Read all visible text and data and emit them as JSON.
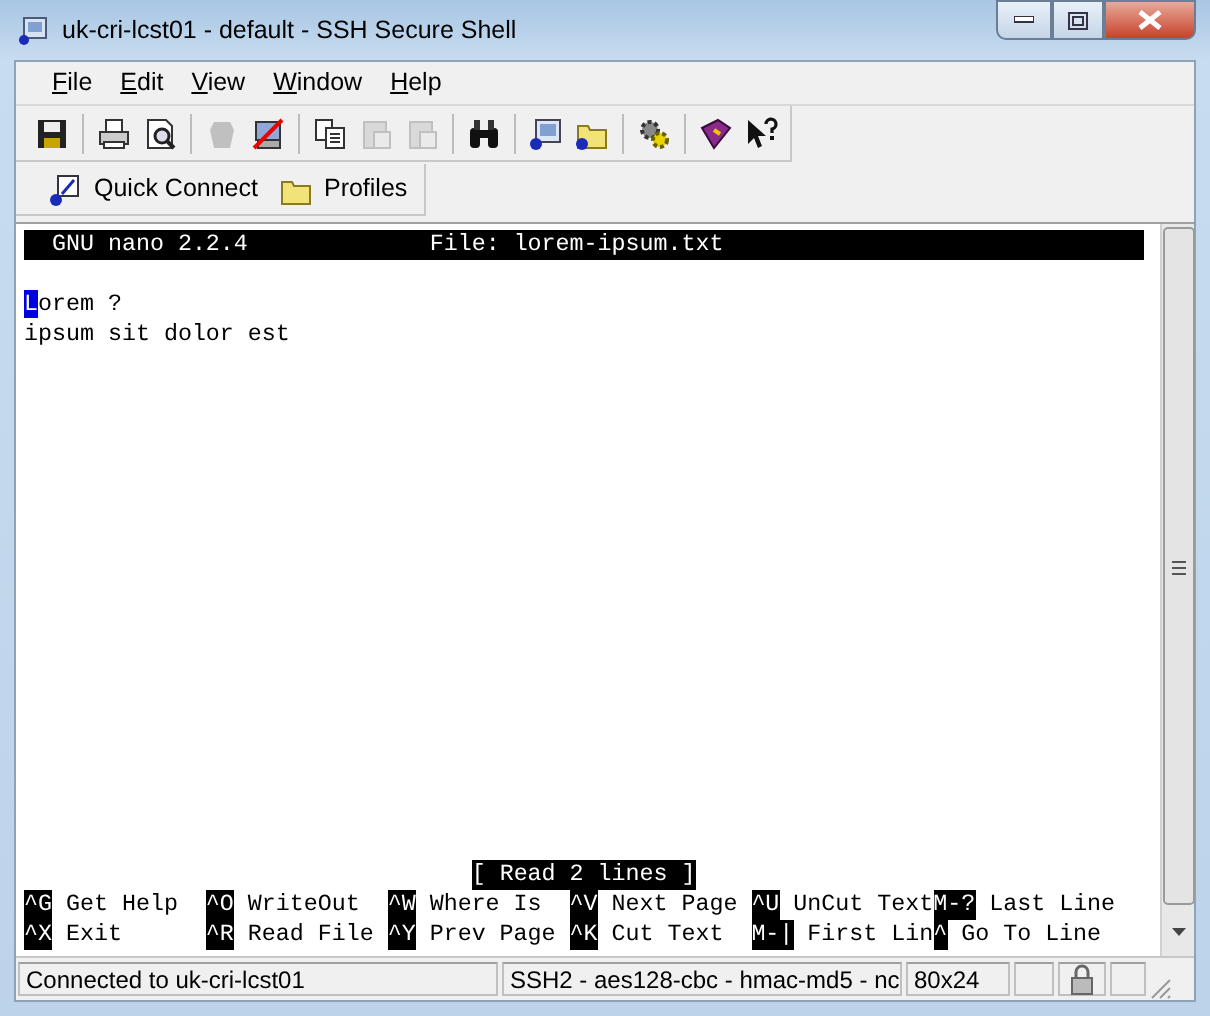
{
  "window": {
    "title": "uk-cri-lcst01 - default - SSH Secure Shell"
  },
  "menu": [
    {
      "label": "File"
    },
    {
      "label": "Edit"
    },
    {
      "label": "View"
    },
    {
      "label": "Window"
    },
    {
      "label": "Help"
    }
  ],
  "toolbar": [
    {
      "kind": "save",
      "disabled": false
    },
    {
      "kind": "separator"
    },
    {
      "kind": "print",
      "disabled": false
    },
    {
      "kind": "preview",
      "disabled": false
    },
    {
      "kind": "separator"
    },
    {
      "kind": "blob",
      "disabled": true
    },
    {
      "kind": "disconnect",
      "disabled": false
    },
    {
      "kind": "separator"
    },
    {
      "kind": "copy",
      "disabled": false
    },
    {
      "kind": "paste",
      "disabled": true
    },
    {
      "kind": "paste",
      "disabled": true
    },
    {
      "kind": "separator"
    },
    {
      "kind": "find",
      "disabled": false
    },
    {
      "kind": "separator"
    },
    {
      "kind": "terminal",
      "disabled": false
    },
    {
      "kind": "folder",
      "disabled": false
    },
    {
      "kind": "separator"
    },
    {
      "kind": "gear",
      "disabled": false
    },
    {
      "kind": "separator"
    },
    {
      "kind": "book",
      "disabled": false
    },
    {
      "kind": "whatsthis",
      "disabled": false
    }
  ],
  "quickbar": [
    {
      "kind": "connect",
      "label": "Quick Connect"
    },
    {
      "kind": "folder",
      "label": "Profiles"
    }
  ],
  "terminal": {
    "header_left": "GNU nano 2.2.4",
    "header_center": "File: lorem-ipsum.txt",
    "lines": [
      {
        "cursor": "L",
        "text": "orem ?"
      },
      {
        "text": "ipsum sit dolor est"
      }
    ],
    "message": "[ Read 2 lines ]",
    "shortcut_rows": [
      [
        {
          "key": "^G",
          "label": "Get Help"
        },
        {
          "key": "^O",
          "label": "WriteOut"
        },
        {
          "key": "^W",
          "label": "Where Is"
        },
        {
          "key": "^V",
          "label": "Next Page"
        },
        {
          "key": "^U",
          "label": "UnCut Text"
        },
        {
          "key": "M-?",
          "label": "Last Line"
        }
      ],
      [
        {
          "key": "^X",
          "label": "Exit"
        },
        {
          "key": "^R",
          "label": "Read File"
        },
        {
          "key": "^Y",
          "label": "Prev Page"
        },
        {
          "key": "^K",
          "label": "Cut Text"
        },
        {
          "key": "M-|",
          "label": "First Lin"
        },
        {
          "key": "^",
          "label": "Go To Line"
        }
      ]
    ]
  },
  "status_bar": {
    "connection": "Connected to uk-cri-lcst01",
    "cipher": "SSH2 - aes128-cbc - hmac-md5 - nc",
    "size": "80x24"
  }
}
